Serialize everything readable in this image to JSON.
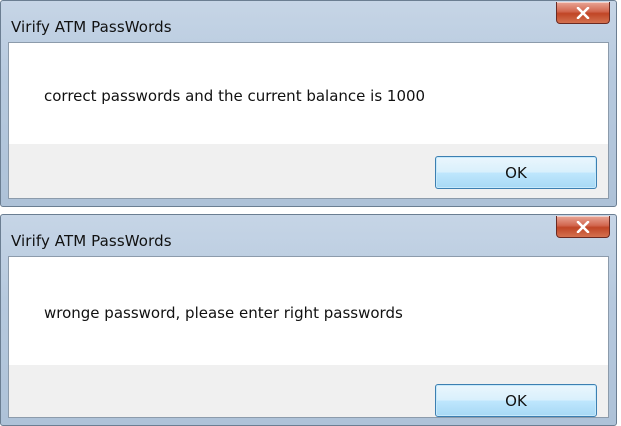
{
  "dialogs": [
    {
      "title": "Virify ATM PassWords",
      "close_glyph": "x",
      "message": "correct passwords and the current balance is 1000",
      "ok_label": "OK"
    },
    {
      "title": "Virify ATM PassWords",
      "close_glyph": "x",
      "message": "wronge password,  please enter right passwords",
      "ok_label": "OK"
    }
  ],
  "icons": {
    "close": "close-icon"
  },
  "colors": {
    "close_button_red": "#c04526",
    "ok_button_border": "#3c7fb1",
    "frame_blue": "#b6c9de"
  }
}
